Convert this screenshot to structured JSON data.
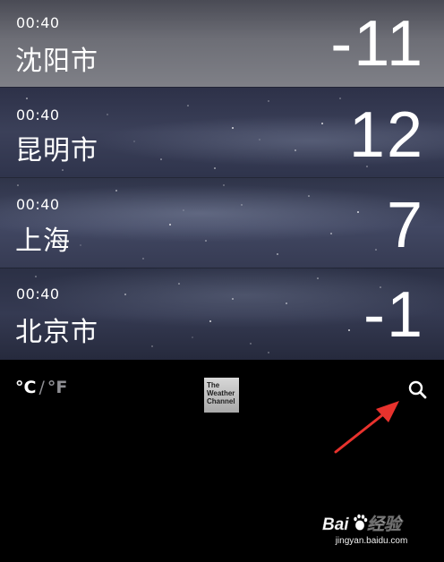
{
  "cities": [
    {
      "time": "00:40",
      "name": "沈阳市",
      "temp": "-11"
    },
    {
      "time": "00:40",
      "name": "昆明市",
      "temp": "12"
    },
    {
      "time": "00:40",
      "name": "上海",
      "temp": "7"
    },
    {
      "time": "00:40",
      "name": "北京市",
      "temp": "-1"
    }
  ],
  "toolbar": {
    "unit_celsius": "°C",
    "unit_separator": "/",
    "unit_fahrenheit": "°F",
    "logo_line1": "The",
    "logo_line2": "Weather",
    "logo_line3": "Channel",
    "search_icon": "search-icon"
  },
  "watermark": {
    "brand": "Baidu经验",
    "url": "jingyan.baidu.com"
  },
  "colors": {
    "background": "#000000",
    "text_primary": "#ffffff",
    "text_secondary": "#8e8e93",
    "annotation_arrow": "#e8322d"
  }
}
